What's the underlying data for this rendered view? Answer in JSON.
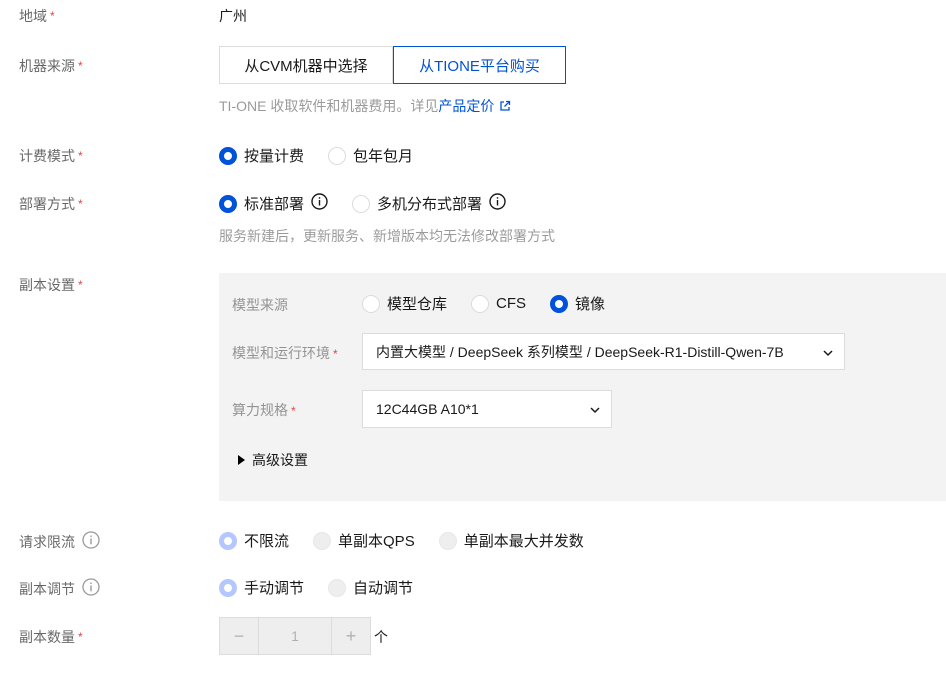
{
  "region": {
    "label": "地域",
    "value": "广州"
  },
  "machine_source": {
    "label": "机器来源",
    "options": [
      "从CVM机器中选择",
      "从TIONE平台购买"
    ],
    "selected_index": 1,
    "hint_prefix": "TI-ONE 收取软件和机器费用。详见",
    "hint_link": "产品定价"
  },
  "billing": {
    "label": "计费模式",
    "options": [
      "按量计费",
      "包年包月"
    ]
  },
  "deploy": {
    "label": "部署方式",
    "options": [
      "标准部署",
      "多机分布式部署"
    ],
    "hint": "服务新建后，更新服务、新增版本均无法修改部署方式"
  },
  "replica": {
    "label": "副本设置",
    "model_source": {
      "label": "模型来源",
      "options": [
        "模型仓库",
        "CFS",
        "镜像"
      ]
    },
    "model_env": {
      "label": "模型和运行环境",
      "value": "内置大模型 / DeepSeek 系列模型 / DeepSeek-R1-Distill-Qwen-7B"
    },
    "compute": {
      "label": "算力规格",
      "value": "12C44GB A10*1"
    },
    "advanced": "高级设置"
  },
  "rate_limit": {
    "label": "请求限流",
    "options": [
      "不限流",
      "单副本QPS",
      "单副本最大并发数"
    ]
  },
  "scaling": {
    "label": "副本调节",
    "options": [
      "手动调节",
      "自动调节"
    ]
  },
  "replica_count": {
    "label": "副本数量",
    "minus": "−",
    "value": "1",
    "plus": "+",
    "unit": "个"
  },
  "required_mark": "*",
  "colors": {
    "primary": "#0052d9",
    "required": "#e54545",
    "panel_bg": "#f3f3f3"
  }
}
